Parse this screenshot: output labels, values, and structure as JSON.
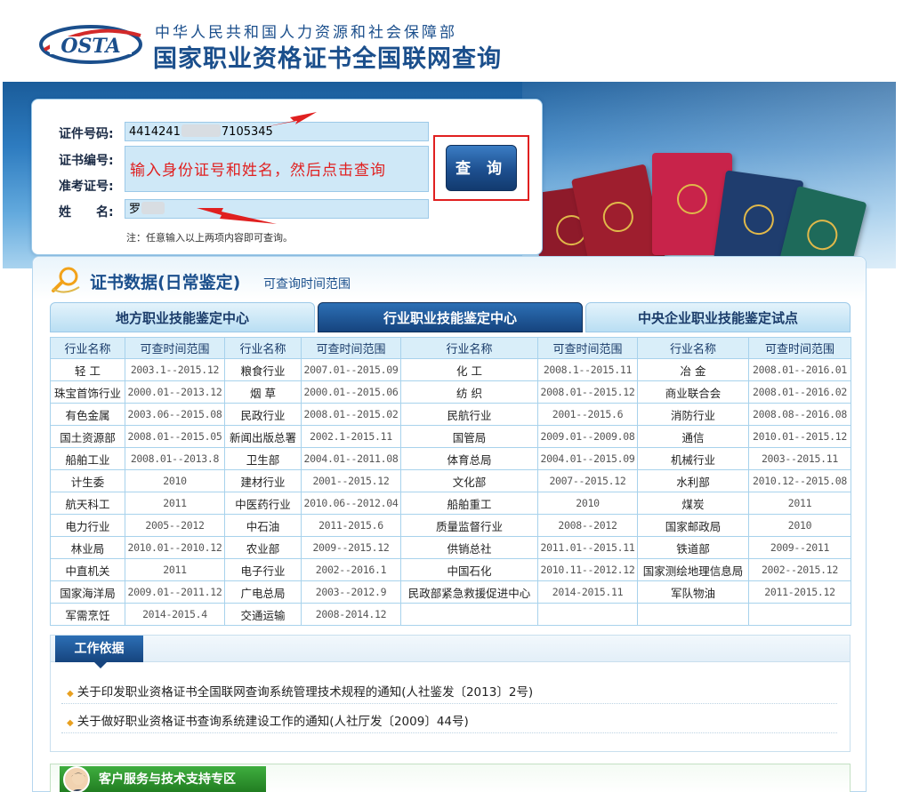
{
  "header": {
    "org_name": "中华人民共和国人力资源和社会保障部",
    "site_title": "国家职业资格证书全国联网查询",
    "logo_text": "OSTA"
  },
  "search": {
    "id_label": "证件号码:",
    "id_value_prefix": "4414241",
    "id_value_suffix": "7105345",
    "cert_label": "证书编号:",
    "exam_label": "准考证号:",
    "name_label": "姓　　名:",
    "name_value": "罗",
    "overlay_instruction": "输入身份证号和姓名，然后点击查询",
    "button_label": "查 询",
    "note": "注：任意输入以上两项内容即可查询。"
  },
  "section": {
    "title": "证书数据(日常鉴定)",
    "subtitle": "可查询时间范围"
  },
  "tabs": [
    {
      "label": "地方职业技能鉴定中心",
      "active": false
    },
    {
      "label": "行业职业技能鉴定中心",
      "active": true
    },
    {
      "label": "中央企业职业技能鉴定试点",
      "active": false
    }
  ],
  "table": {
    "headers": [
      "行业名称",
      "可查时间范围",
      "行业名称",
      "可查时间范围",
      "行业名称",
      "可查时间范围",
      "行业名称",
      "可查时间范围"
    ],
    "rows": [
      [
        "轻 工",
        "2003.1--2015.12",
        "粮食行业",
        "2007.01--2015.09",
        "化 工",
        "2008.1--2015.11",
        "冶 金",
        "2008.01--2016.01"
      ],
      [
        "珠宝首饰行业",
        "2000.01--2013.12",
        "烟 草",
        "2000.01--2015.06",
        "纺 织",
        "2008.01--2015.12",
        "商业联合会",
        "2008.01--2016.02"
      ],
      [
        "有色金属",
        "2003.06--2015.08",
        "民政行业",
        "2008.01--2015.02",
        "民航行业",
        "2001--2015.6",
        "消防行业",
        "2008.08--2016.08"
      ],
      [
        "国土资源部",
        "2008.01--2015.05",
        "新闻出版总署",
        "2002.1-2015.11",
        "国管局",
        "2009.01--2009.08",
        "通信",
        "2010.01--2015.12"
      ],
      [
        "船舶工业",
        "2008.01--2013.8",
        "卫生部",
        "2004.01--2011.08",
        "体育总局",
        "2004.01--2015.09",
        "机械行业",
        "2003--2015.11"
      ],
      [
        "计生委",
        "2010",
        "建材行业",
        "2001--2015.12",
        "文化部",
        "2007--2015.12",
        "水利部",
        "2010.12--2015.08"
      ],
      [
        "航天科工",
        "2011",
        "中医药行业",
        "2010.06--2012.04",
        "船舶重工",
        "2010",
        "煤炭",
        "2011"
      ],
      [
        "电力行业",
        "2005--2012",
        "中石油",
        "2011-2015.6",
        "质量监督行业",
        "2008--2012",
        "国家邮政局",
        "2010"
      ],
      [
        "林业局",
        "2010.01--2010.12",
        "农业部",
        "2009--2015.12",
        "供销总社",
        "2011.01--2015.11",
        "铁道部",
        "2009--2011"
      ],
      [
        "中直机关",
        "2011",
        "电子行业",
        "2002--2016.1",
        "中国石化",
        "2010.11--2012.12",
        "国家测绘地理信息局",
        "2002--2015.12"
      ],
      [
        "国家海洋局",
        "2009.01--2011.12",
        "广电总局",
        "2003--2012.9",
        "民政部紧急救援促进中心",
        "2014-2015.11",
        "军队物油",
        "2011-2015.12"
      ],
      [
        "军需烹饪",
        "2014-2015.4",
        "交通运输",
        "2008-2014.12",
        "",
        "",
        "",
        ""
      ]
    ]
  },
  "basis": {
    "title": "工作依据",
    "links": [
      "关于印发职业资格证书全国联网查询系统管理技术规程的通知(人社鉴发〔2013〕2号)",
      "关于做好职业资格证书查询系统建设工作的通知(人社厅发〔2009〕44号)"
    ]
  },
  "service": {
    "title": "客户服务与技术支持专区"
  },
  "colors": {
    "brand_blue": "#1b4f8c",
    "annotation_red": "#e02020",
    "service_green": "#2a8f2a"
  }
}
